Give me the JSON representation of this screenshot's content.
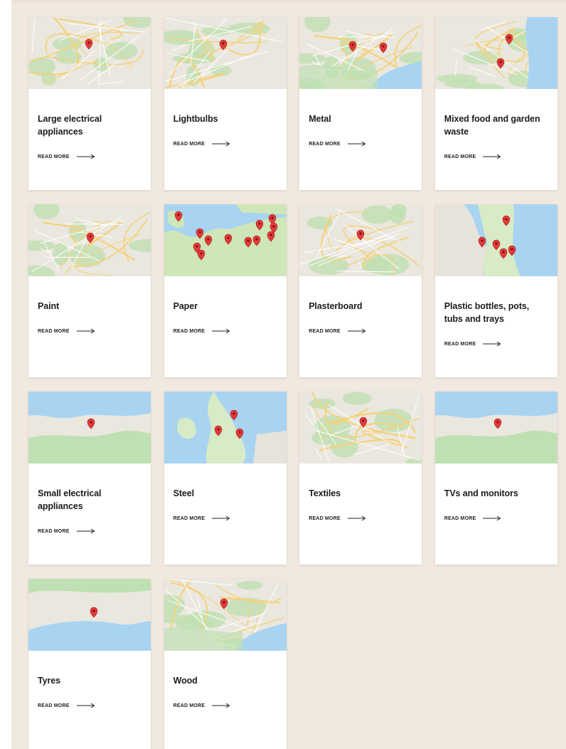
{
  "read_more_label": "READ MORE",
  "colors": {
    "panel_bg": "#f1e8df",
    "card_bg": "#ffffff",
    "marker": "#e23a3a",
    "water": "#a8d4f2",
    "land": "#eae7df",
    "green": "#bfe0b2"
  },
  "cards": [
    {
      "title": "Large electrical appliances",
      "map": "roads",
      "pins": 1
    },
    {
      "title": "Lightbulbs",
      "map": "roads",
      "pins": 1
    },
    {
      "title": "Metal",
      "map": "estuary",
      "pins": 2
    },
    {
      "title": "Mixed food and garden waste",
      "map": "coast-east",
      "pins": 2
    },
    {
      "title": "Paint",
      "map": "roads",
      "pins": 1
    },
    {
      "title": "Paper",
      "map": "europe",
      "pins": 12
    },
    {
      "title": "Plasterboard",
      "map": "roads",
      "pins": 1
    },
    {
      "title": "Plastic bottles, pots, tubs and trays",
      "map": "uk-east",
      "pins": 5
    },
    {
      "title": "Small electrical appliances",
      "map": "thames",
      "pins": 1
    },
    {
      "title": "Steel",
      "map": "uk-wide",
      "pins": 3
    },
    {
      "title": "Textiles",
      "map": "roads",
      "pins": 1
    },
    {
      "title": "TVs and monitors",
      "map": "thames",
      "pins": 1
    },
    {
      "title": "Tyres",
      "map": "south-coast",
      "pins": 1
    },
    {
      "title": "Wood",
      "map": "estuary",
      "pins": 1
    }
  ]
}
